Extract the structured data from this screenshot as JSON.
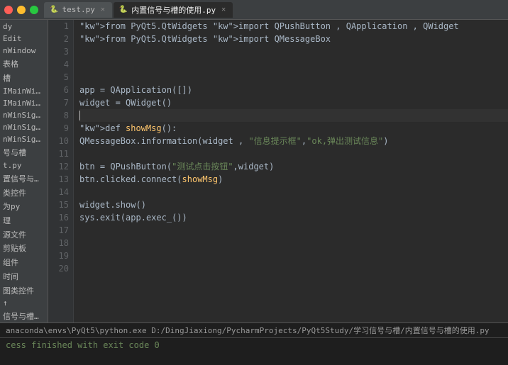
{
  "titleBar": {
    "tabs": [
      {
        "id": "test",
        "label": "test.py",
        "active": false,
        "icon": "py"
      },
      {
        "id": "signals",
        "label": "内置信号与槽的使用.py",
        "active": true,
        "icon": "py"
      }
    ]
  },
  "sidebar": {
    "items": [
      {
        "id": "project",
        "label": "dy",
        "indent": 0
      },
      {
        "id": "edit",
        "label": "Edit",
        "indent": 0
      },
      {
        "id": "view",
        "label": "nWindow",
        "indent": 0
      },
      {
        "id": "tables",
        "label": "表格",
        "indent": 0
      },
      {
        "id": "slots",
        "label": "槽",
        "indent": 0
      },
      {
        "id": "signal1",
        "label": "IMainWinSigna",
        "indent": 0
      },
      {
        "id": "signal2",
        "label": "IMainWinSigna",
        "indent": 0
      },
      {
        "id": "signal3",
        "label": "nWinSignalSlc",
        "indent": 0
      },
      {
        "id": "signal4",
        "label": "nWinSignalSlc",
        "indent": 0
      },
      {
        "id": "signal5",
        "label": "nWinSignalSlc",
        "indent": 0
      },
      {
        "id": "signal6",
        "label": "号与槽",
        "indent": 0
      },
      {
        "id": "testpy",
        "label": "t.py",
        "indent": 0
      },
      {
        "id": "signaluse",
        "label": "置信号与槽的使用",
        "indent": 0
      },
      {
        "id": "types",
        "label": "类控件",
        "indent": 0
      },
      {
        "id": "forpy",
        "label": "为py",
        "indent": 0
      },
      {
        "id": "manage",
        "label": "理",
        "indent": 0
      },
      {
        "id": "source",
        "label": "源文件",
        "indent": 0
      },
      {
        "id": "clipboard",
        "label": "剪贴板",
        "indent": 0
      },
      {
        "id": "files",
        "label": "组件",
        "indent": 0
      },
      {
        "id": "time",
        "label": "时间",
        "indent": 0
      },
      {
        "id": "figure",
        "label": "图类控件",
        "indent": 0
      },
      {
        "id": "arrow",
        "label": "↑",
        "indent": 0
      },
      {
        "id": "signalbottom",
        "label": "信号与槽的使用",
        "indent": 0
      }
    ]
  },
  "code": {
    "lines": [
      {
        "num": 1,
        "content": "from PyQt5.QtWidgets import QPushButton , QApplication , QWidget",
        "type": "normal"
      },
      {
        "num": 2,
        "content": "from PyQt5.QtWidgets import QMessageBox",
        "type": "normal"
      },
      {
        "num": 3,
        "content": "",
        "type": "normal"
      },
      {
        "num": 4,
        "content": "",
        "type": "normal"
      },
      {
        "num": 5,
        "content": "",
        "type": "normal"
      },
      {
        "num": 6,
        "content": "app = QApplication([])",
        "type": "normal"
      },
      {
        "num": 7,
        "content": "widget = QWidget()",
        "type": "normal"
      },
      {
        "num": 8,
        "content": "",
        "type": "highlight"
      },
      {
        "num": 9,
        "content": "def showMsg():",
        "type": "normal"
      },
      {
        "num": 10,
        "content": "    QMessageBox.information(widget , \"信息提示框\",\"ok,弹出测试信息\")",
        "type": "normal"
      },
      {
        "num": 11,
        "content": "",
        "type": "normal"
      },
      {
        "num": 12,
        "content": "btn = QPushButton(\"测试点击按钮\",widget)",
        "type": "normal"
      },
      {
        "num": 13,
        "content": "btn.clicked.connect(showMsg)",
        "type": "normal"
      },
      {
        "num": 14,
        "content": "",
        "type": "normal"
      },
      {
        "num": 15,
        "content": "widget.show()",
        "type": "normal"
      },
      {
        "num": 16,
        "content": "sys.exit(app.exec_())",
        "type": "normal"
      },
      {
        "num": 17,
        "content": "",
        "type": "normal"
      },
      {
        "num": 18,
        "content": "",
        "type": "normal"
      },
      {
        "num": 19,
        "content": "",
        "type": "normal"
      },
      {
        "num": 20,
        "content": "",
        "type": "normal"
      }
    ]
  },
  "bottomPanel": {
    "runPath": "anaconda\\envs\\PyQt5\\python.exe D:/DingJiaxiong/PycharmProjects/PyQt5Study/学习信号与槽/内置信号与槽的使用.py",
    "output": "cess finished with exit code 0"
  }
}
